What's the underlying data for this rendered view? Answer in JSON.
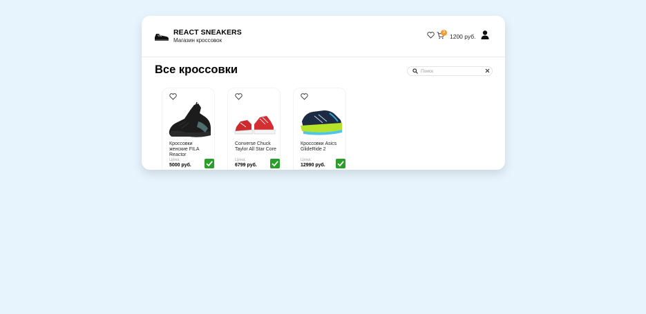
{
  "header": {
    "brand_title": "REACT SNEAKERS",
    "brand_subtitle": "Магазин кроссовок",
    "cart_count": "3",
    "cart_total": "1200 руб.",
    "icons": [
      "sneaker-logo-icon",
      "heart-icon",
      "cart-icon",
      "user-icon"
    ]
  },
  "main": {
    "title": "Все кроссовки",
    "search": {
      "placeholder": "Поиск",
      "value": ""
    }
  },
  "products": [
    {
      "name": "Кроссовки женские FILA Reactor",
      "price_label": "Цена:",
      "price": "5000 руб.",
      "in_cart": true,
      "favorite": false
    },
    {
      "name": "Converse Chuck Taylor All Star Core",
      "price_label": "Цена:",
      "price": "6799 руб.",
      "in_cart": true,
      "favorite": false
    },
    {
      "name": "Кроссовки Asics GlideRide 2",
      "price_label": "Цена:",
      "price": "12990 руб.",
      "in_cart": true,
      "favorite": false
    }
  ],
  "colors": {
    "background": "#e7f4fd",
    "badge": "#f29a38",
    "check": "#2a9d2a"
  }
}
